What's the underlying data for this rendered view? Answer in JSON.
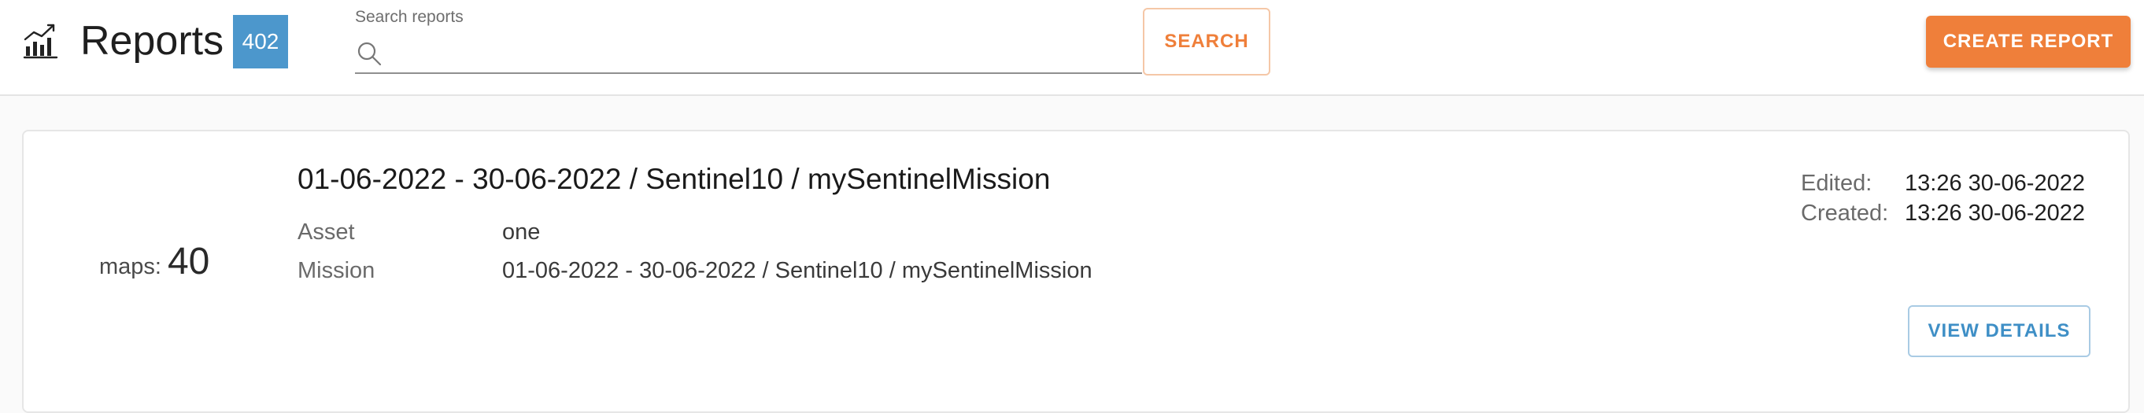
{
  "header": {
    "title": "Reports",
    "count": "402",
    "search": {
      "label": "Search reports",
      "placeholder": "",
      "value": ""
    },
    "search_button_label": "SEARCH",
    "create_button_label": "CREATE REPORT",
    "icons": {
      "logo": "chart-icon",
      "search": "search-icon"
    }
  },
  "report": {
    "maps_label": "maps:",
    "maps_count": "40",
    "title": "01-06-2022 - 30-06-2022 / Sentinel10 / mySentinelMission",
    "details": [
      {
        "label": "Asset",
        "value": "one"
      },
      {
        "label": "Mission",
        "value": "01-06-2022 - 30-06-2022 / Sentinel10 / mySentinelMission"
      }
    ],
    "meta": [
      {
        "label": "Edited:",
        "value": "13:26 30-06-2022"
      },
      {
        "label": "Created:",
        "value": "13:26 30-06-2022"
      }
    ],
    "view_button_label": "VIEW DETAILS"
  },
  "colors": {
    "accent_orange": "#ef7f3a",
    "badge_blue": "#4c97cc",
    "link_blue": "#3f8fc6",
    "background": "#fafafa"
  }
}
